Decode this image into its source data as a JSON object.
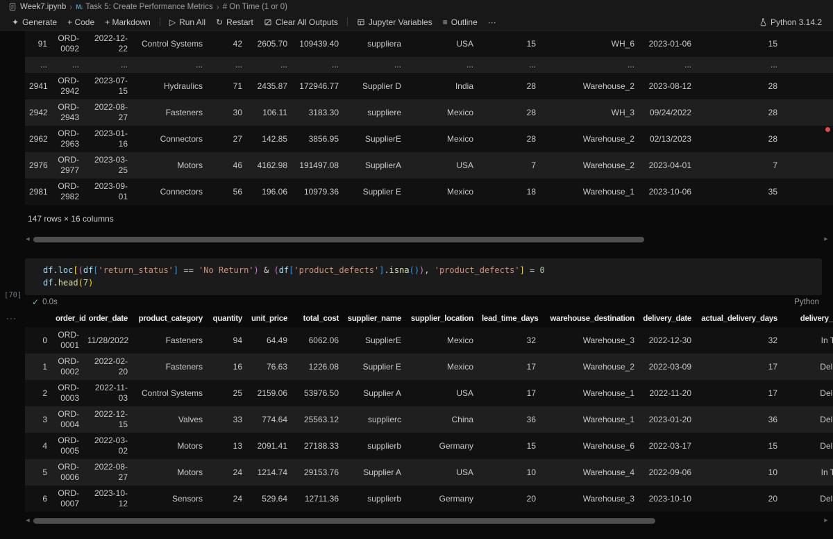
{
  "breadcrumb": {
    "file_name": "Week7.ipynb",
    "section": "Task 5: Create Performance Metrics",
    "cell_label": "# On Time (1 or 0)"
  },
  "toolbar": {
    "generate": "Generate",
    "add_code": "+ Code",
    "add_markdown": "+ Markdown",
    "run_all": "Run All",
    "restart": "Restart",
    "clear_all_outputs": "Clear All Outputs",
    "jupyter_variables": "Jupyter Variables",
    "outline": "Outline",
    "kernel_label": "Python 3.14.2"
  },
  "icons": {
    "chevron": "›",
    "sparkle": "✦",
    "plus_code": "+",
    "plus_markdown": "+",
    "play": "▷",
    "restart": "↻",
    "outline": "≡",
    "more": "···",
    "markdown_badge": "M↓",
    "check": "✓",
    "scroll_left": "◀",
    "scroll_right": "▶"
  },
  "colors": {
    "error_dot": "#E5484D",
    "success_check": "#73C991",
    "row_dark": "#111111",
    "row_light": "#1F1F1F"
  },
  "output_table_top": {
    "rows": [
      [
        "91",
        "ORD-0092",
        "2022-12-22",
        "Control Systems",
        "42",
        "2605.70",
        "109439.40",
        "suppliera",
        "USA",
        "15",
        "WH_6",
        "2023-01-06",
        "15",
        ""
      ],
      [
        "...",
        "...",
        "...",
        "...",
        "...",
        "...",
        "...",
        "...",
        "...",
        "...",
        "...",
        "...",
        "...",
        ""
      ],
      [
        "2941",
        "ORD-2942",
        "2023-07-15",
        "Hydraulics",
        "71",
        "2435.87",
        "172946.77",
        "Supplier D",
        "India",
        "28",
        "Warehouse_2",
        "2023-08-12",
        "28",
        ""
      ],
      [
        "2942",
        "ORD-2943",
        "2022-08-27",
        "Fasteners",
        "30",
        "106.11",
        "3183.30",
        "suppliere",
        "Mexico",
        "28",
        "WH_3",
        "09/24/2022",
        "28",
        ""
      ],
      [
        "2962",
        "ORD-2963",
        "2023-01-16",
        "Connectors",
        "27",
        "142.85",
        "3856.95",
        "SupplierE",
        "Mexico",
        "28",
        "Warehouse_2",
        "02/13/2023",
        "28",
        ""
      ],
      [
        "2976",
        "ORD-2977",
        "2023-03-25",
        "Motors",
        "46",
        "4162.98",
        "191497.08",
        "SupplierA",
        "USA",
        "7",
        "Warehouse_2",
        "2023-04-01",
        "7",
        ""
      ],
      [
        "2981",
        "ORD-2982",
        "2023-09-01",
        "Connectors",
        "56",
        "196.06",
        "10979.36",
        "Supplier E",
        "Mexico",
        "18",
        "Warehouse_1",
        "2023-10-06",
        "35",
        ""
      ]
    ]
  },
  "table_summary": "147 rows × 16 columns",
  "code_cell": {
    "execution_count": "[70]",
    "status_time": "0.0s",
    "language_label": "Python",
    "lines": [
      [
        {
          "t": "df",
          "c": "v"
        },
        {
          "t": ".",
          "c": "o"
        },
        {
          "t": "loc",
          "c": "v"
        },
        {
          "t": "[",
          "c": "b1"
        },
        {
          "t": "(",
          "c": "b2"
        },
        {
          "t": "df",
          "c": "v"
        },
        {
          "t": "[",
          "c": "b3"
        },
        {
          "t": "'return_status'",
          "c": "s"
        },
        {
          "t": "]",
          "c": "b3"
        },
        {
          "t": " == ",
          "c": "o"
        },
        {
          "t": "'No Return'",
          "c": "s"
        },
        {
          "t": ")",
          "c": "b2"
        },
        {
          "t": " & ",
          "c": "o"
        },
        {
          "t": "(",
          "c": "b2"
        },
        {
          "t": "df",
          "c": "v"
        },
        {
          "t": "[",
          "c": "b3"
        },
        {
          "t": "'product_defects'",
          "c": "s"
        },
        {
          "t": "]",
          "c": "b3"
        },
        {
          "t": ".",
          "c": "o"
        },
        {
          "t": "isna",
          "c": "f"
        },
        {
          "t": "(",
          "c": "b3"
        },
        {
          "t": ")",
          "c": "b3"
        },
        {
          "t": ")",
          "c": "b2"
        },
        {
          "t": ", ",
          "c": "o"
        },
        {
          "t": "'product_defects'",
          "c": "s"
        },
        {
          "t": "]",
          "c": "b1"
        },
        {
          "t": " = ",
          "c": "o"
        },
        {
          "t": "0",
          "c": "n"
        }
      ],
      [
        {
          "t": "df",
          "c": "v"
        },
        {
          "t": ".",
          "c": "o"
        },
        {
          "t": "head",
          "c": "f"
        },
        {
          "t": "(",
          "c": "b1"
        },
        {
          "t": "7",
          "c": "n"
        },
        {
          "t": ")",
          "c": "b1"
        }
      ]
    ]
  },
  "output_table_bottom": {
    "headers": [
      "",
      "order_id",
      "order_date",
      "product_category",
      "quantity",
      "unit_price",
      "total_cost",
      "supplier_name",
      "supplier_location",
      "lead_time_days",
      "warehouse_destination",
      "delivery_date",
      "actual_delivery_days",
      "delivery_status"
    ],
    "rows": [
      [
        "0",
        "ORD-0001",
        "11/28/2022",
        "Fasteners",
        "94",
        "64.49",
        "6062.06",
        "SupplierE",
        "Mexico",
        "32",
        "Warehouse_3",
        "2022-12-30",
        "32",
        "In Transit"
      ],
      [
        "1",
        "ORD-0002",
        "2022-02-20",
        "Fasteners",
        "16",
        "76.63",
        "1226.08",
        "Supplier E",
        "Mexico",
        "17",
        "Warehouse_2",
        "2022-03-09",
        "17",
        "Delivered"
      ],
      [
        "2",
        "ORD-0003",
        "2022-11-03",
        "Control Systems",
        "25",
        "2159.06",
        "53976.50",
        "Supplier A",
        "USA",
        "17",
        "Warehouse_1",
        "2022-11-20",
        "17",
        "Delivered"
      ],
      [
        "3",
        "ORD-0004",
        "2022-12-15",
        "Valves",
        "33",
        "774.64",
        "25563.12",
        "supplierc",
        "China",
        "36",
        "Warehouse_1",
        "2023-01-20",
        "36",
        "Delivered"
      ],
      [
        "4",
        "ORD-0005",
        "2022-03-02",
        "Motors",
        "13",
        "2091.41",
        "27188.33",
        "supplierb",
        "Germany",
        "15",
        "Warehouse_6",
        "2022-03-17",
        "15",
        "Delivered"
      ],
      [
        "5",
        "ORD-0006",
        "2022-08-27",
        "Motors",
        "24",
        "1214.74",
        "29153.76",
        "Supplier A",
        "USA",
        "10",
        "Warehouse_4",
        "2022-09-06",
        "10",
        "In Transit"
      ],
      [
        "6",
        "ORD-0007",
        "2023-10-12",
        "Sensors",
        "24",
        "529.64",
        "12711.36",
        "supplierb",
        "Germany",
        "20",
        "Warehouse_3",
        "2023-10-10",
        "20",
        "Delivered"
      ]
    ]
  }
}
